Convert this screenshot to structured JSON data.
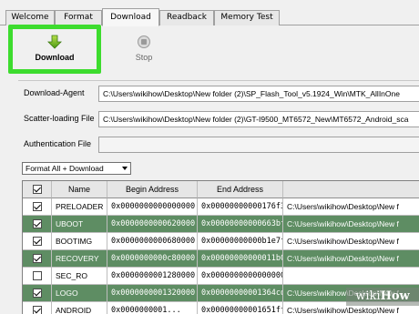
{
  "tabs": [
    {
      "label": "Welcome",
      "active": false
    },
    {
      "label": "Format",
      "active": false
    },
    {
      "label": "Download",
      "active": true
    },
    {
      "label": "Readback",
      "active": false
    },
    {
      "label": "Memory Test",
      "active": false
    }
  ],
  "toolbar": {
    "download_label": "Download",
    "stop_label": "Stop",
    "highlight_color": "#3ddc2e"
  },
  "fields": {
    "download_agent_label": "Download-Agent",
    "download_agent_value": "C:\\Users\\wikihow\\Desktop\\New folder (2)\\SP_Flash_Tool_v5.1924_Win\\MTK_AllInOne",
    "scatter_label": "Scatter-loading File",
    "scatter_value": "C:\\Users\\wikihow\\Desktop\\New folder (2)\\GT-I9500_MT6572_New\\MT6572_Android_sca",
    "auth_label": "Authentication File",
    "auth_value": ""
  },
  "mode_select": {
    "value": "Format All + Download"
  },
  "table": {
    "headers": [
      "",
      "Name",
      "Begin Address",
      "End Address",
      ""
    ],
    "rows": [
      {
        "checked": true,
        "name": "PRELOADER",
        "begin": "0x0000000000000000",
        "end": "0x00000000000176f3",
        "location": "C:\\Users\\wikihow\\Desktop\\New f",
        "highlight": false
      },
      {
        "checked": true,
        "name": "UBOOT",
        "begin": "0x0000000000620000",
        "end": "0x00000000000663bff",
        "location": "C:\\Users\\wikihow\\Desktop\\New f",
        "highlight": true
      },
      {
        "checked": true,
        "name": "BOOTIMG",
        "begin": "0x0000000000680000",
        "end": "0x00000000000b1e7ff",
        "location": "C:\\Users\\wikihow\\Desktop\\New f",
        "highlight": false
      },
      {
        "checked": true,
        "name": "RECOVERY",
        "begin": "0x0000000000c80000",
        "end": "0x00000000000011b0ff",
        "location": "C:\\Users\\wikihow\\Desktop\\New f",
        "highlight": true
      },
      {
        "checked": false,
        "name": "SEC_RO",
        "begin": "0x0000000001280000",
        "end": "0x0000000000000000",
        "location": "",
        "highlight": false
      },
      {
        "checked": true,
        "name": "LOGO",
        "begin": "0x0000000001320000",
        "end": "0x00000000001364cdf",
        "location": "C:\\Users\\wikihow\\Desktop\\New f",
        "highlight": true
      },
      {
        "checked": true,
        "name": "ANDROID",
        "begin": "0x0000000001...",
        "end": "0x00000000001651fff",
        "location": "C:\\Users\\wikihow\\Desktop\\New f",
        "highlight": false
      }
    ],
    "highlight_color": "#5e8d63"
  },
  "watermark": {
    "prefix": "wiki",
    "suffix": "How"
  }
}
